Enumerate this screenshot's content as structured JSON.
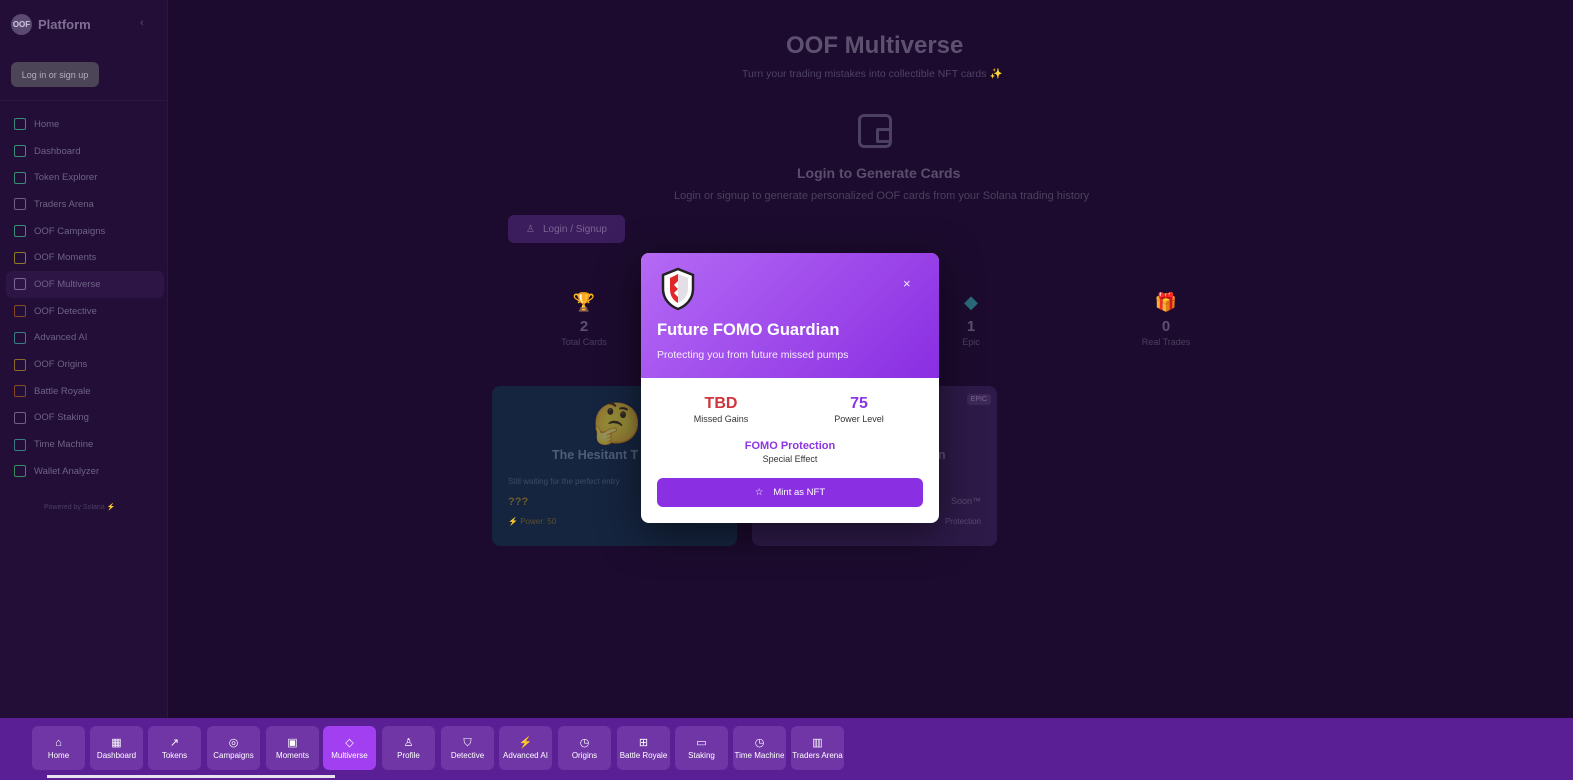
{
  "sidebar": {
    "brand_logo": "OOF",
    "brand_title": "Platform",
    "collapse_icon": "chevron-left-icon",
    "login_label": "Log in or sign up",
    "items": [
      {
        "label": "Home",
        "icon": "home-icon",
        "color": "#3a8c7a"
      },
      {
        "label": "Dashboard",
        "icon": "grid-icon",
        "color": "#3a8c7a"
      },
      {
        "label": "Token Explorer",
        "icon": "trending-up-icon",
        "color": "#3a8c7a"
      },
      {
        "label": "Traders Arena",
        "icon": "bar-chart-icon",
        "color": "#6d5f85"
      },
      {
        "label": "OOF Campaigns",
        "icon": "target-icon",
        "color": "#3a8c7a"
      },
      {
        "label": "OOF Moments",
        "icon": "star-icon",
        "color": "#8a7a2a"
      },
      {
        "label": "OOF Multiverse",
        "icon": "sparkles-icon",
        "color": "#7a6a95"
      },
      {
        "label": "OOF Detective",
        "icon": "shield-icon",
        "color": "#8a4a2a"
      },
      {
        "label": "Advanced AI",
        "icon": "zap-icon",
        "color": "#3a7a8c"
      },
      {
        "label": "OOF Origins",
        "icon": "calendar-icon",
        "color": "#8a6a2a"
      },
      {
        "label": "Battle Royale",
        "icon": "gamepad-icon",
        "color": "#8a4a2a"
      },
      {
        "label": "OOF Staking",
        "icon": "coins-icon",
        "color": "#6d5f85"
      },
      {
        "label": "Time Machine",
        "icon": "clock-icon",
        "color": "#3a7a8c"
      },
      {
        "label": "Wallet Analyzer",
        "icon": "gem-icon",
        "color": "#3a8c5a"
      }
    ],
    "powered_by": "Powered by Solana ⚡"
  },
  "main": {
    "title": "OOF Multiverse",
    "subtitle": "Turn your trading mistakes into collectible NFT cards",
    "subtitle_icon": "✨",
    "login_heading": "Login to Generate Cards",
    "login_desc": "Login or signup to generate personalized OOF cards from your Solana trading history",
    "login_button": "Login / Signup",
    "stats": [
      {
        "value": "2",
        "label": "Total Cards",
        "icon": "trophy-icon",
        "color": "#6b5a1c"
      },
      {
        "value": "1",
        "label": "Epic",
        "icon": "gem-icon",
        "color": "#2a6a7a"
      },
      {
        "value": "0",
        "label": "Real Trades",
        "icon": "gift-icon",
        "color": "#2a6a4a"
      }
    ],
    "card1": {
      "emoji": "🤔",
      "title": "The Hesitant T",
      "desc": "Still waiting for the perfect entry",
      "missed": "???",
      "power": "Power: 50"
    },
    "card2": {
      "badge": "EPIC",
      "title": "n",
      "soon": "Soon™",
      "protection": "Protection"
    }
  },
  "modal": {
    "title": "Future FOMO Guardian",
    "subtitle": "Protecting you from future missed pumps",
    "close": "×",
    "missed_value": "TBD",
    "missed_label": "Missed Gains",
    "missed_color": "#d0343c",
    "power_value": "75",
    "power_label": "Power Level",
    "power_color": "#8b35e3",
    "effect_title": "FOMO Protection",
    "effect_label": "Special Effect",
    "mint_label": "Mint as NFT"
  },
  "bottom_nav": [
    {
      "label": "Home",
      "icon": "⌂"
    },
    {
      "label": "Dashboard",
      "icon": "▦"
    },
    {
      "label": "Tokens",
      "icon": "↗"
    },
    {
      "label": "Campaigns",
      "icon": "◎"
    },
    {
      "label": "Moments",
      "icon": "▣"
    },
    {
      "label": "Multiverse",
      "icon": "◇",
      "active": true
    },
    {
      "label": "Profile",
      "icon": "♙"
    },
    {
      "label": "Detective",
      "icon": "⛉"
    },
    {
      "label": "Advanced AI",
      "icon": "⚡"
    },
    {
      "label": "Origins",
      "icon": "◷"
    },
    {
      "label": "Battle Royale",
      "icon": "⊞"
    },
    {
      "label": "Staking",
      "icon": "▭"
    },
    {
      "label": "Time Machine",
      "icon": "◷"
    },
    {
      "label": "Traders Arena",
      "icon": "▥"
    }
  ]
}
